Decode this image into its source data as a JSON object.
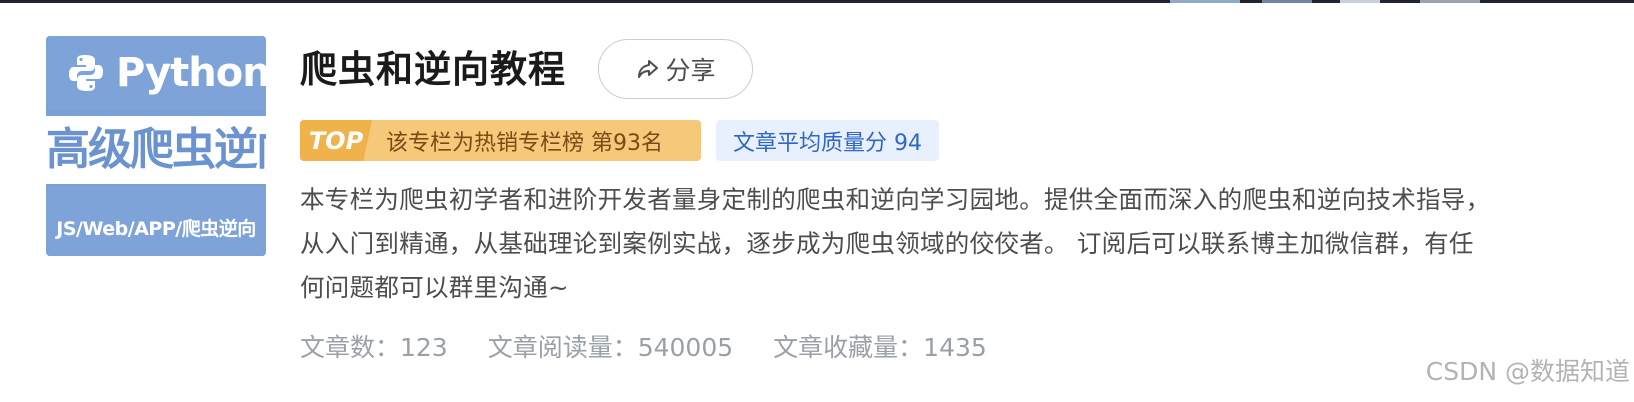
{
  "cover": {
    "logo_text": "Python",
    "main_text": "高级爬虫逆向",
    "sub_text": "JS/Web/APP/爬虫逆向",
    "colors": {
      "band": "#7ea3d9",
      "main_text": "#6a93cf"
    }
  },
  "header": {
    "title": "爬虫和逆向教程",
    "share_icon": "share-arrow-icon",
    "share_label": "分享"
  },
  "badges": {
    "top_tag": "TOP",
    "top_text": "该专栏为热销专栏榜 第93名",
    "quality_text": "文章平均质量分 94"
  },
  "description": {
    "lines": [
      "本专栏为爬虫初学者和进阶开发者量身定制的爬虫和逆向学习园地。提供全面而深入的爬虫和逆向技术指导，",
      "从入门到精通，从基础理论到案例实战，逐步成为爬虫领域的佼佼者。 订阅后可以联系博主加微信群，有任",
      "何问题都可以群里沟通~"
    ]
  },
  "stats": {
    "articles": "文章数：123",
    "reads": "文章阅读量：540005",
    "favorites": "文章收藏量：1435"
  },
  "watermark": "CSDN @数据知道"
}
